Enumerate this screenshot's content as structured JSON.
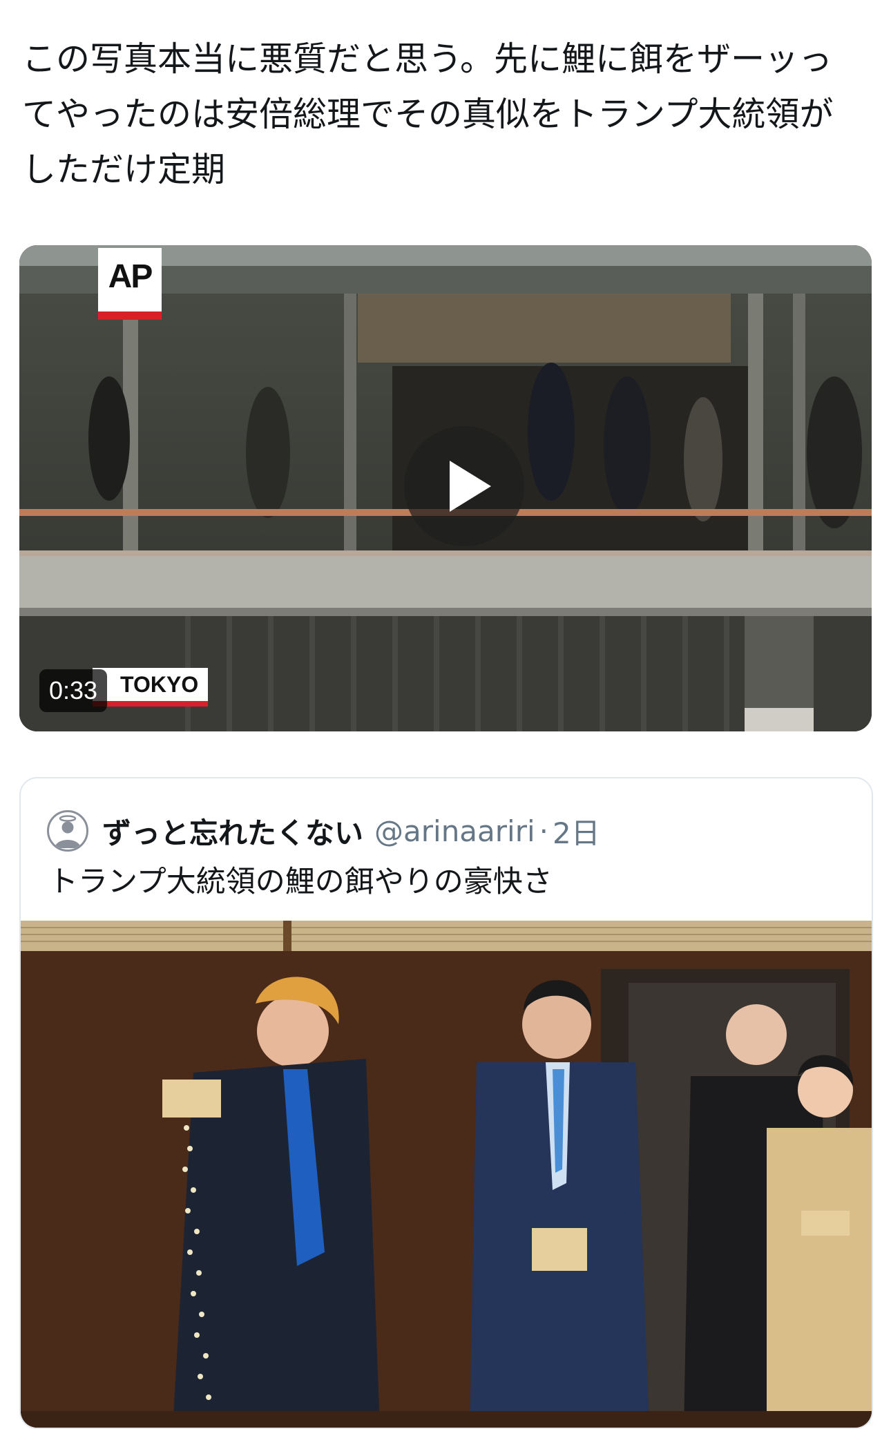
{
  "tweet": {
    "text": "この写真本当に悪質だと思う。先に鯉に餌をザーッっ\nてやったのは安倍総理でその真似をトランプ大統領が\nしただけ定期"
  },
  "video": {
    "duration": "0:33",
    "watermark": "AP",
    "location_caption": "TOKYO"
  },
  "quote": {
    "author_name": "ずっと忘れたくない",
    "handle": "@arinaariri",
    "separator": "·",
    "date": "2日",
    "text": "トランプ大統領の鯉の餌やりの豪快さ"
  },
  "colors": {
    "text_primary": "#14171a",
    "text_secondary": "#657786",
    "card_border": "#e1e8ed"
  },
  "icons": {
    "play": "play-icon",
    "avatar": "default-avatar-icon"
  }
}
